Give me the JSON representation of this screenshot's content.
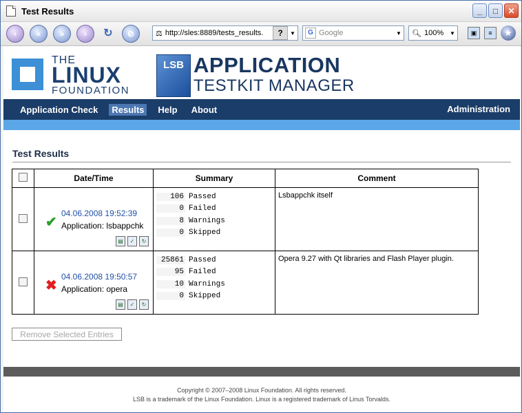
{
  "window": {
    "title": "Test Results"
  },
  "browser": {
    "url": "http://sles:8889/tests_results.",
    "search_placeholder": "Google",
    "zoom": "100%"
  },
  "header": {
    "lf_the": "THE",
    "lf_linux": "LINUX",
    "lf_foundation": "FOUNDATION",
    "lsb": "LSB",
    "app_line1": "APPLICATION",
    "app_line2": "TESTKIT MANAGER"
  },
  "nav": {
    "items": [
      "Application Check",
      "Results",
      "Help",
      "About"
    ],
    "active": "Results",
    "admin": "Administration"
  },
  "page": {
    "heading": "Test Results",
    "columns": [
      "Date/Time",
      "Summary",
      "Comment"
    ],
    "rows": [
      {
        "status": "passed",
        "date": "04.06.2008 19:52:39",
        "application": "Application: lsbappchk",
        "summary": [
          {
            "num": "106",
            "label": "Passed"
          },
          {
            "num": "0",
            "label": "Failed"
          },
          {
            "num": "8",
            "label": "Warnings"
          },
          {
            "num": "0",
            "label": "Skipped"
          }
        ],
        "comment": "Lsbappchk itself"
      },
      {
        "status": "failed",
        "date": "04.06.2008 19:50:57",
        "application": "Application: opera",
        "summary": [
          {
            "num": "25861",
            "label": "Passed"
          },
          {
            "num": "95",
            "label": "Failed"
          },
          {
            "num": "10",
            "label": "Warnings"
          },
          {
            "num": "0",
            "label": "Skipped"
          }
        ],
        "comment": "Opera 9.27 with Qt libraries and Flash Player plugin."
      }
    ],
    "remove_button": "Remove Selected Entries"
  },
  "footer": {
    "line1": "Copyright © 2007–2008 Linux Foundation. All rights reserved.",
    "line2": "LSB is a trademark of the Linux Foundation. Linux is a registered trademark of Linus Torvalds."
  }
}
